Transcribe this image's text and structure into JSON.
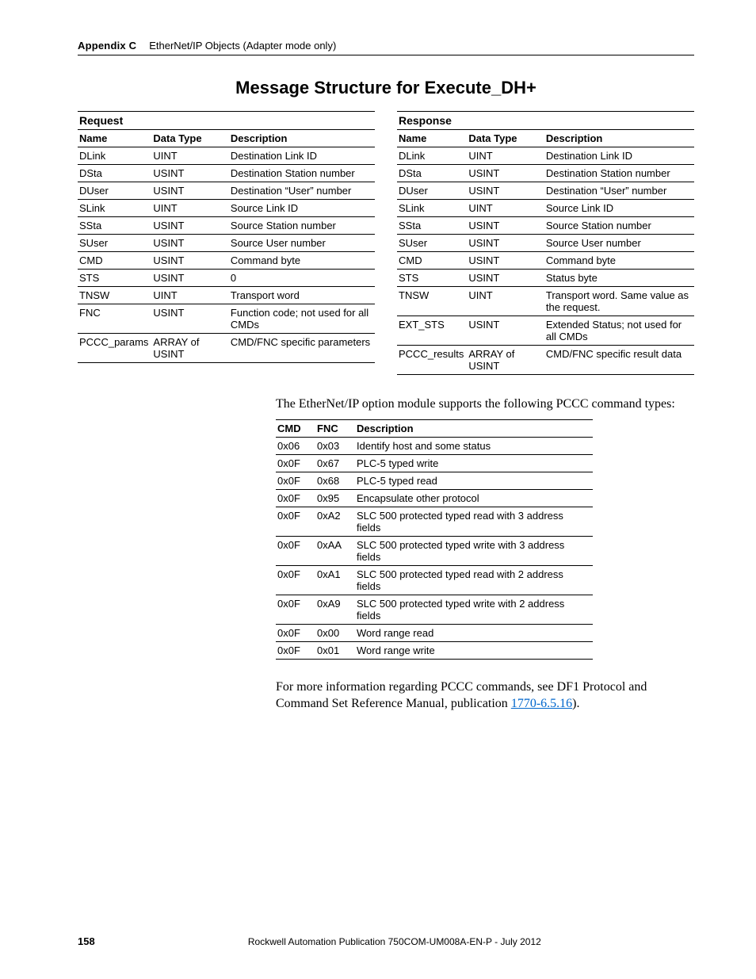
{
  "header": {
    "appendix": "Appendix C",
    "title": "EtherNet/IP Objects (Adapter mode only)"
  },
  "section_title": "Message Structure for Execute_DH+",
  "request_table": {
    "caption": "Request",
    "headers": [
      "Name",
      "Data Type",
      "Description"
    ],
    "rows": [
      [
        "DLink",
        "UINT",
        "Destination Link ID"
      ],
      [
        "DSta",
        "USINT",
        "Destination Station number"
      ],
      [
        "DUser",
        "USINT",
        "Destination “User” number"
      ],
      [
        "SLink",
        "UINT",
        "Source Link ID"
      ],
      [
        "SSta",
        "USINT",
        "Source Station number"
      ],
      [
        "SUser",
        "USINT",
        "Source User number"
      ],
      [
        "CMD",
        "USINT",
        "Command byte"
      ],
      [
        "STS",
        "USINT",
        "0"
      ],
      [
        "TNSW",
        "UINT",
        "Transport word"
      ],
      [
        "FNC",
        "USINT",
        "Function code; not used for all CMDs"
      ],
      [
        "PCCC_params",
        "ARRAY of USINT",
        "CMD/FNC specific parameters"
      ]
    ]
  },
  "response_table": {
    "caption": "Response",
    "headers": [
      "Name",
      "Data Type",
      "Description"
    ],
    "rows": [
      [
        "DLink",
        "UINT",
        "Destination Link ID"
      ],
      [
        "DSta",
        "USINT",
        "Destination Station number"
      ],
      [
        "DUser",
        "USINT",
        "Destination “User” number"
      ],
      [
        "SLink",
        "UINT",
        "Source Link ID"
      ],
      [
        "SSta",
        "USINT",
        "Source Station number"
      ],
      [
        "SUser",
        "USINT",
        "Source User number"
      ],
      [
        "CMD",
        "USINT",
        "Command byte"
      ],
      [
        "STS",
        "USINT",
        "Status byte"
      ],
      [
        "TNSW",
        "UINT",
        "Transport word. Same value as the request."
      ],
      [
        "EXT_STS",
        "USINT",
        "Extended Status; not used for all CMDs"
      ],
      [
        "PCCC_results",
        "ARRAY of USINT",
        "CMD/FNC specific result data"
      ]
    ]
  },
  "intro_text": "The EtherNet/IP option module supports the following PCCC command types:",
  "cmd_table": {
    "headers": [
      "CMD",
      "FNC",
      "Description"
    ],
    "rows": [
      [
        "0x06",
        "0x03",
        "Identify host and some status"
      ],
      [
        "0x0F",
        "0x67",
        "PLC-5 typed write"
      ],
      [
        "0x0F",
        "0x68",
        "PLC-5 typed read"
      ],
      [
        "0x0F",
        "0x95",
        "Encapsulate other protocol"
      ],
      [
        "0x0F",
        "0xA2",
        "SLC 500 protected typed read with 3 address fields"
      ],
      [
        "0x0F",
        "0xAA",
        "SLC 500 protected typed write with 3 address fields"
      ],
      [
        "0x0F",
        "0xA1",
        "SLC 500 protected typed read with 2 address fields"
      ],
      [
        "0x0F",
        "0xA9",
        "SLC 500 protected typed write with 2 address fields"
      ],
      [
        "0x0F",
        "0x00",
        "Word range read"
      ],
      [
        "0x0F",
        "0x01",
        "Word range write"
      ]
    ]
  },
  "more_info_pre": "For more information regarding PCCC commands, see DF1 Protocol and Command Set Reference Manual, publication ",
  "more_info_link": "1770-6.5.16",
  "more_info_post": ").",
  "footer": {
    "page": "158",
    "publication": "Rockwell Automation Publication 750COM-UM008A-EN-P - July 2012"
  }
}
